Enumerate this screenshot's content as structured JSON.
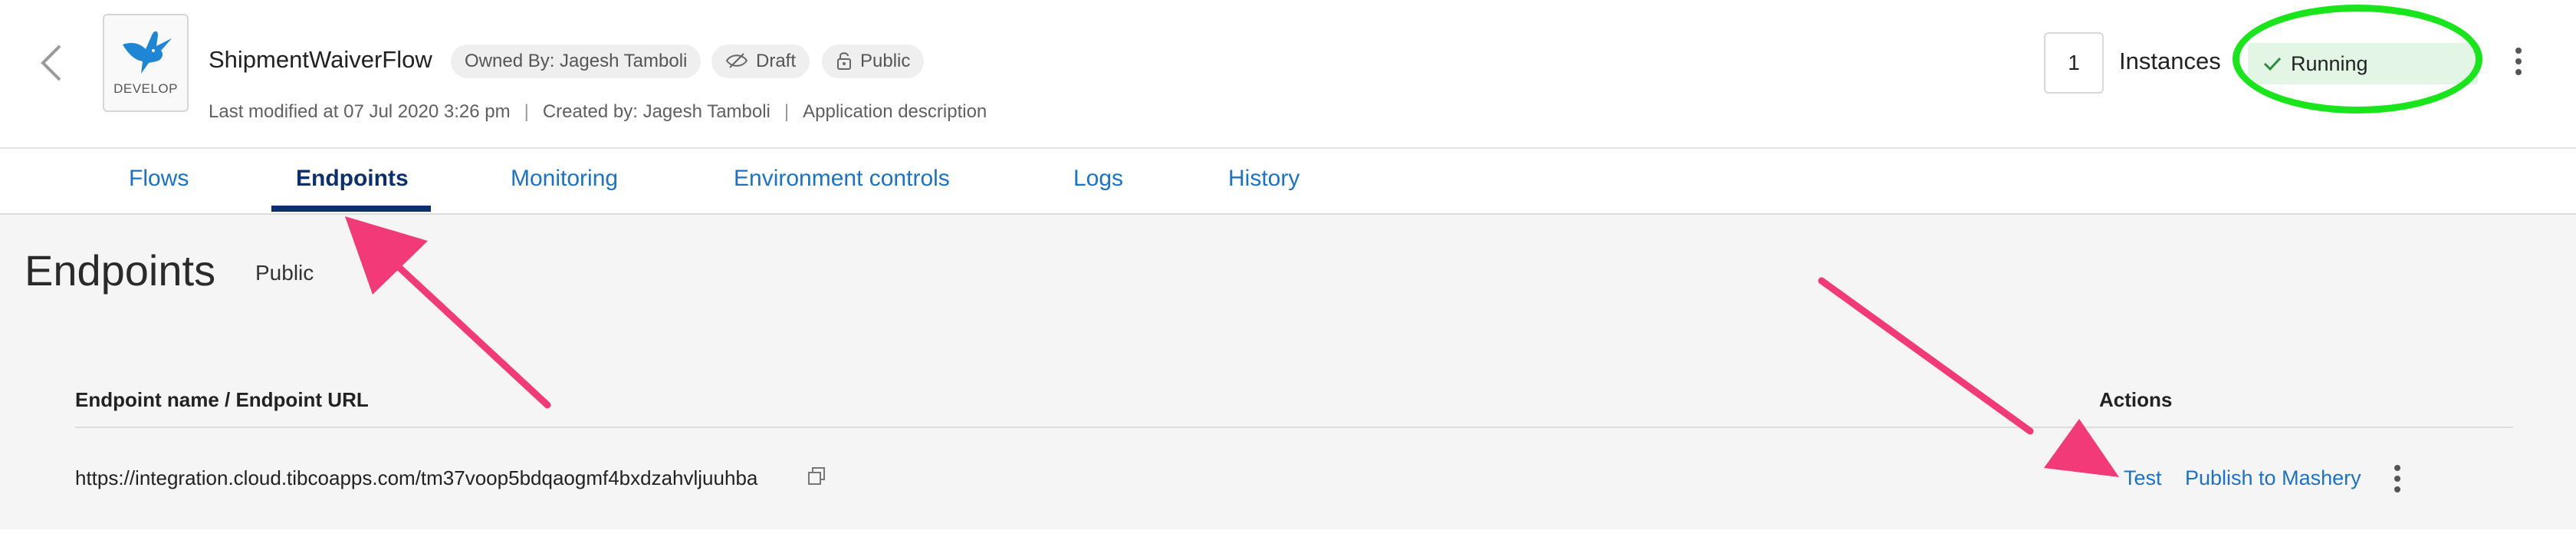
{
  "header": {
    "logo_label": "DEVELOP",
    "app_name": "ShipmentWaiverFlow",
    "owner_chip": "Owned By: Jagesh Tamboli",
    "status_chip": "Draft",
    "visibility_chip": "Public",
    "last_modified": "Last modified at 07 Jul 2020 3:26 pm",
    "created_by": "Created by: Jagesh Tamboli",
    "description_link": "Application description",
    "meta_separator": "|",
    "instances_count": "1",
    "instances_label": "Instances",
    "run_status": "Running",
    "status_color": "#e3f6e6"
  },
  "tabs": [
    {
      "label": "Flows"
    },
    {
      "label": "Endpoints",
      "active": true
    },
    {
      "label": "Monitoring"
    },
    {
      "label": "Environment controls"
    },
    {
      "label": "Logs"
    },
    {
      "label": "History"
    }
  ],
  "main": {
    "title": "Endpoints",
    "subtitle": "Public",
    "columns": {
      "name": "Endpoint name / Endpoint URL",
      "actions": "Actions"
    },
    "rows": [
      {
        "url": "https://integration.cloud.tibcoapps.com/tm37voop5bdqaogmf4bxdzahvljuuhba",
        "actions": [
          "Test",
          "Publish to Mashery"
        ]
      }
    ]
  },
  "colors": {
    "link": "#1a73c8",
    "active_tab": "#0d2f6b",
    "annotation_arrow": "#f23a78",
    "annotation_ellipse": "#19e51b"
  }
}
